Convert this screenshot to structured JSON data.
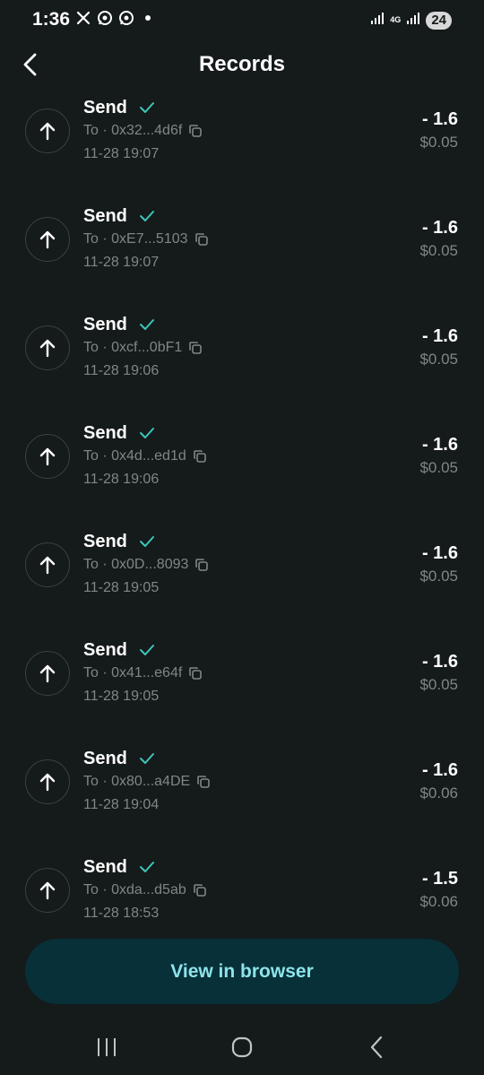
{
  "status_bar": {
    "time": "1:36",
    "left_icons": [
      "x-logo-icon",
      "whatsapp-icon",
      "whatsapp-icon"
    ],
    "network": "4G",
    "battery": "24"
  },
  "header": {
    "title": "Records"
  },
  "records": [
    {
      "type": "Send",
      "to": "To · 0x32...4d6f",
      "time": "11-28 19:07",
      "amount": "- 1.6",
      "usd": "$0.05"
    },
    {
      "type": "Send",
      "to": "To · 0xE7...5103",
      "time": "11-28 19:07",
      "amount": "- 1.6",
      "usd": "$0.05"
    },
    {
      "type": "Send",
      "to": "To · 0xcf...0bF1",
      "time": "11-28 19:06",
      "amount": "- 1.6",
      "usd": "$0.05"
    },
    {
      "type": "Send",
      "to": "To · 0x4d...ed1d",
      "time": "11-28 19:06",
      "amount": "- 1.6",
      "usd": "$0.05"
    },
    {
      "type": "Send",
      "to": "To · 0x0D...8093",
      "time": "11-28 19:05",
      "amount": "- 1.6",
      "usd": "$0.05"
    },
    {
      "type": "Send",
      "to": "To · 0x41...e64f",
      "time": "11-28 19:05",
      "amount": "- 1.6",
      "usd": "$0.05"
    },
    {
      "type": "Send",
      "to": "To · 0x80...a4DE",
      "time": "11-28 19:04",
      "amount": "- 1.6",
      "usd": "$0.06"
    },
    {
      "type": "Send",
      "to": "To · 0xda...d5ab",
      "time": "11-28 18:53",
      "amount": "- 1.5",
      "usd": "$0.06"
    }
  ],
  "footer": {
    "view_button_label": "View in browser"
  },
  "colors": {
    "background": "#151a1b",
    "accent_check": "#3cc7b8",
    "button_bg": "#073038",
    "button_text": "#8ee3ea",
    "muted_text": "#7e8788"
  }
}
